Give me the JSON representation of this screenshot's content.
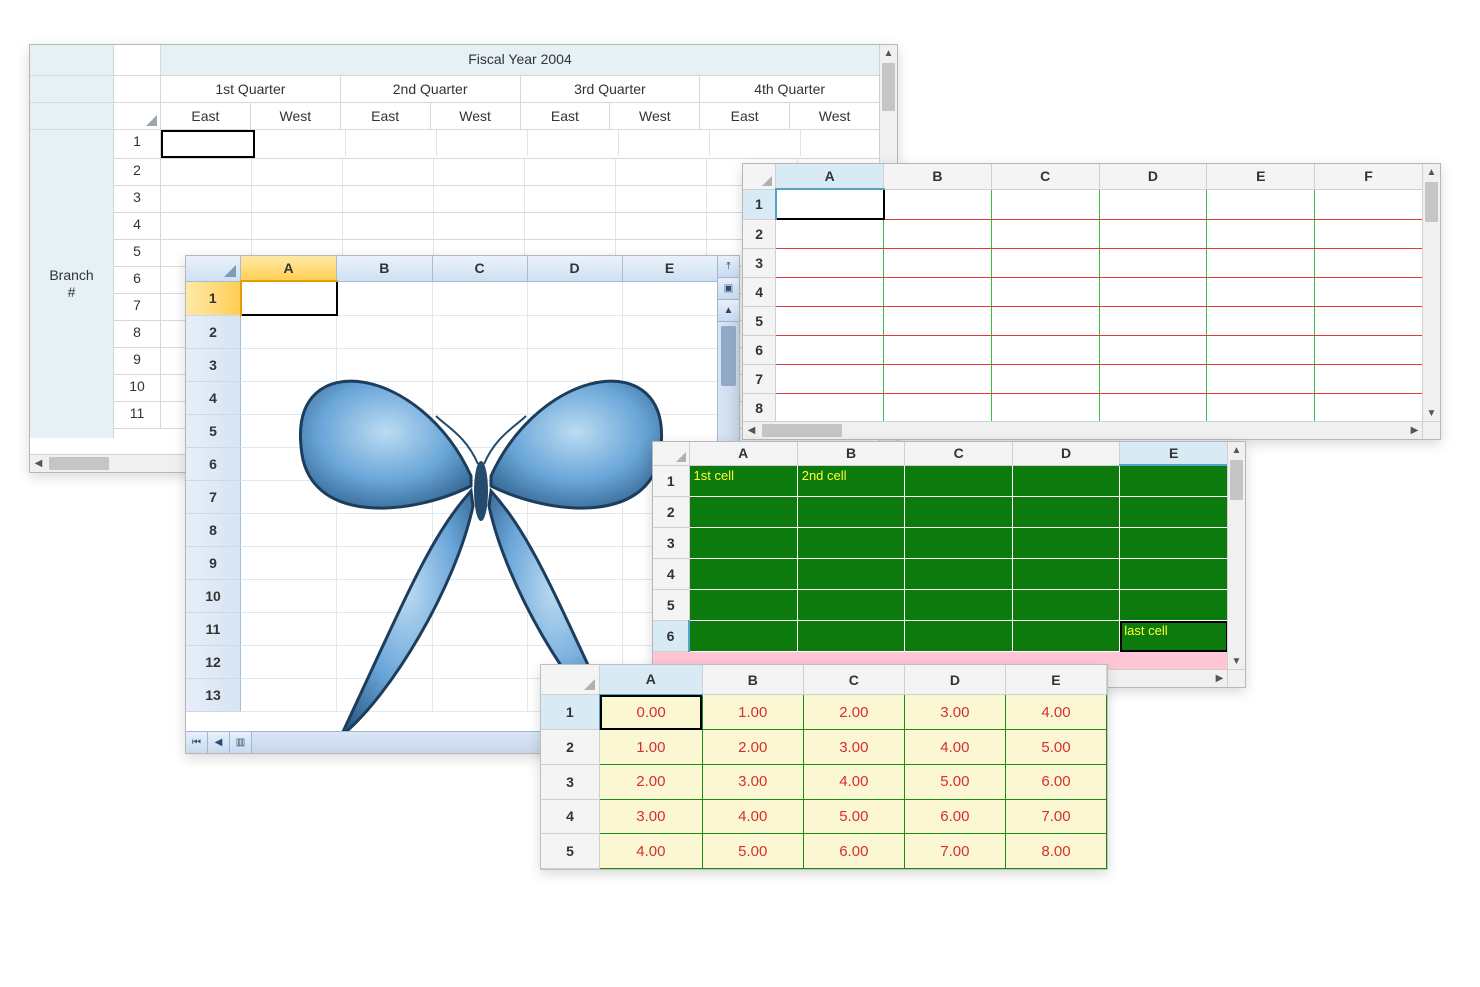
{
  "pane1": {
    "title": "Fiscal Year 2004",
    "stub_label": "Branch\n#",
    "quarters": [
      "1st Quarter",
      "2nd Quarter",
      "3rd Quarter",
      "4th Quarter"
    ],
    "subcols": [
      "East",
      "West"
    ],
    "row_headers": [
      "1",
      "2",
      "3",
      "4",
      "5",
      "6",
      "7",
      "8",
      "9",
      "10",
      "11"
    ],
    "selected": {
      "row": 0,
      "col": 0
    }
  },
  "pane2": {
    "columns": [
      "A",
      "B",
      "C",
      "D",
      "E"
    ],
    "row_headers": [
      "1",
      "2",
      "3",
      "4",
      "5",
      "6",
      "7",
      "8",
      "9",
      "10",
      "11",
      "12",
      "13"
    ],
    "selected": {
      "row": 0,
      "col": 0
    },
    "image_name": "butterfly-image",
    "scroll_buttons": {
      "page_up": "⯯",
      "line_up": "▲",
      "line_up2": "▲",
      "line_down": "▼"
    }
  },
  "pane3": {
    "columns": [
      "A",
      "B",
      "C",
      "D",
      "E",
      "F"
    ],
    "row_headers": [
      "1",
      "2",
      "3",
      "4",
      "5",
      "6",
      "7",
      "8"
    ],
    "selected": {
      "row": 0,
      "col": 0
    },
    "gridline_h_color": "#e23b3b",
    "gridline_v_color": "#3bbd3b"
  },
  "pane4": {
    "columns": [
      "A",
      "B",
      "C",
      "D",
      "E"
    ],
    "row_headers": [
      "1",
      "2",
      "3",
      "4",
      "5",
      "6"
    ],
    "selected": {
      "row": 5,
      "col": 4
    },
    "cells": {
      "0": {
        "0": "1st cell",
        "1": "2nd cell"
      },
      "5": {
        "4": "last cell"
      }
    },
    "cell_bg": "#0c7a0c",
    "sheet_bg": "#ffc6d6",
    "text_color": "#ffff33"
  },
  "pane5": {
    "columns": [
      "A",
      "B",
      "C",
      "D",
      "E"
    ],
    "row_headers": [
      "1",
      "2",
      "3",
      "4",
      "5"
    ],
    "selected": {
      "row": 0,
      "col": 0
    },
    "values": [
      [
        "0.00",
        "1.00",
        "2.00",
        "3.00",
        "4.00"
      ],
      [
        "1.00",
        "2.00",
        "3.00",
        "4.00",
        "5.00"
      ],
      [
        "2.00",
        "3.00",
        "4.00",
        "5.00",
        "6.00"
      ],
      [
        "3.00",
        "4.00",
        "5.00",
        "6.00",
        "7.00"
      ],
      [
        "4.00",
        "5.00",
        "6.00",
        "7.00",
        "8.00"
      ]
    ]
  }
}
